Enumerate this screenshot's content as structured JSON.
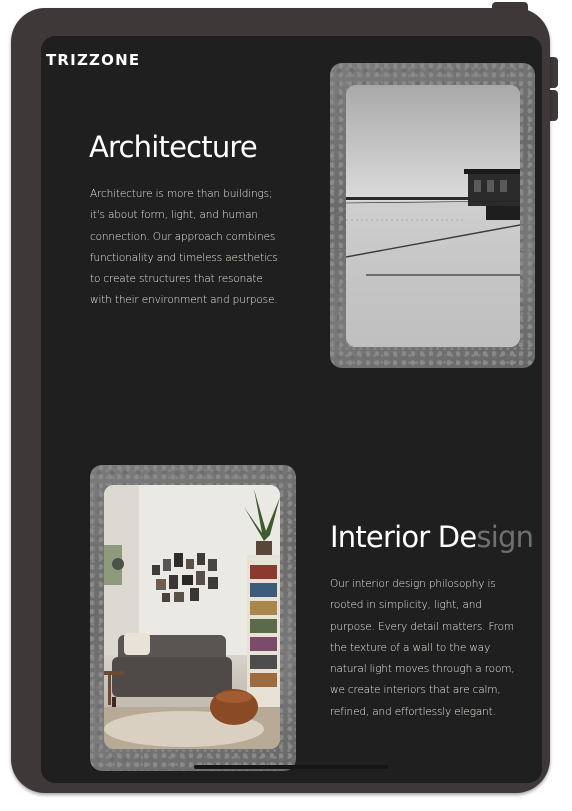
{
  "brand": {
    "name": "TRIZZONE"
  },
  "architecture": {
    "title": "Architecture",
    "lines": [
      "Architecture is more than buildings;",
      "it's about form, light, and human",
      "connection. Our approach combines",
      "functionality and timeless aesthetics",
      "to create structures that resonate",
      "with their environment and purpose."
    ],
    "image_alt": "Black and white photo of a waterfront building over still water"
  },
  "interior": {
    "title_main": "Interior De",
    "title_fade": "sign",
    "lines": [
      "Our interior design philosophy is",
      "rooted in simplicity, light, and",
      "purpose. Every detail matters. From",
      "the texture of a wall to the way",
      "natural light moves through a room,",
      "we create interiors that are calm,",
      "refined, and effortlessly elegant."
    ],
    "image_alt": "Living room with grey sofa, gallery wall, bookshelf and leather pouf"
  },
  "colors": {
    "device": "#3e3838",
    "screen": "#1f1f1f",
    "text": "#ffffff",
    "body_text": "#ece7de",
    "frame": "#757575"
  }
}
